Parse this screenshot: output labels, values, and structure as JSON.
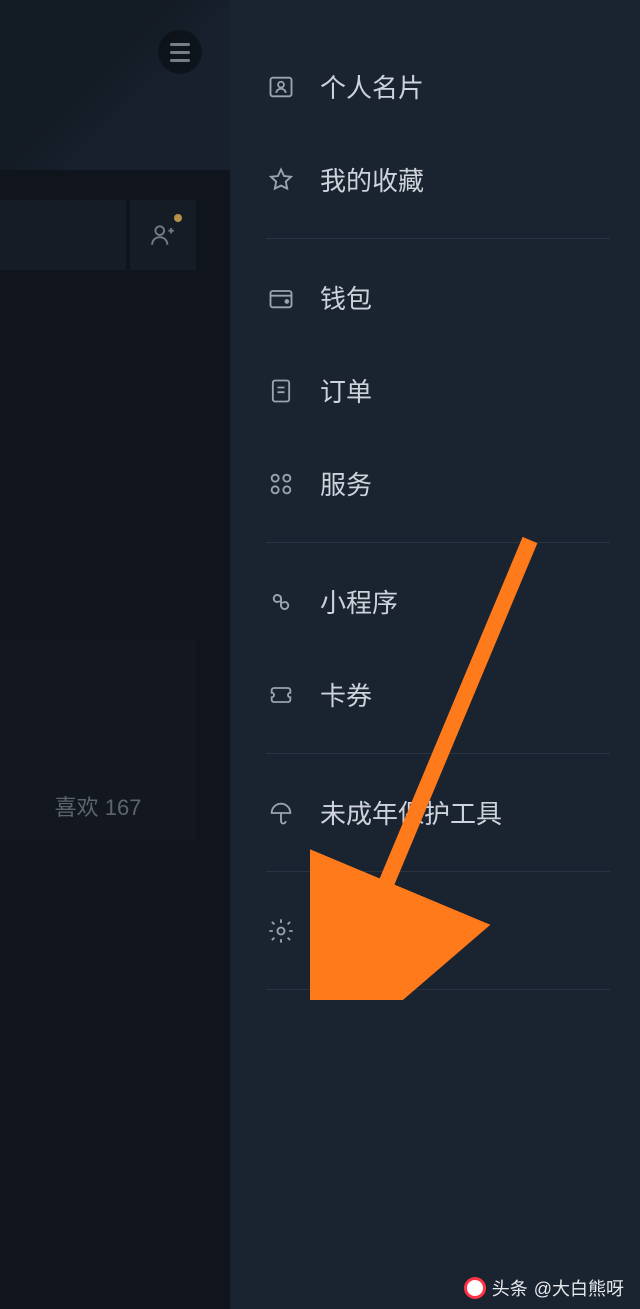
{
  "bg": {
    "likes_label": "喜欢",
    "likes_count": "167"
  },
  "menu": {
    "profile_card": "个人名片",
    "favorites": "我的收藏",
    "wallet": "钱包",
    "orders": "订单",
    "services": "服务",
    "mini_programs": "小程序",
    "coupons": "卡券",
    "minor_protection": "未成年保护工具",
    "settings": "设置"
  },
  "credit": {
    "source": "头条",
    "author": "@大白熊呀"
  }
}
